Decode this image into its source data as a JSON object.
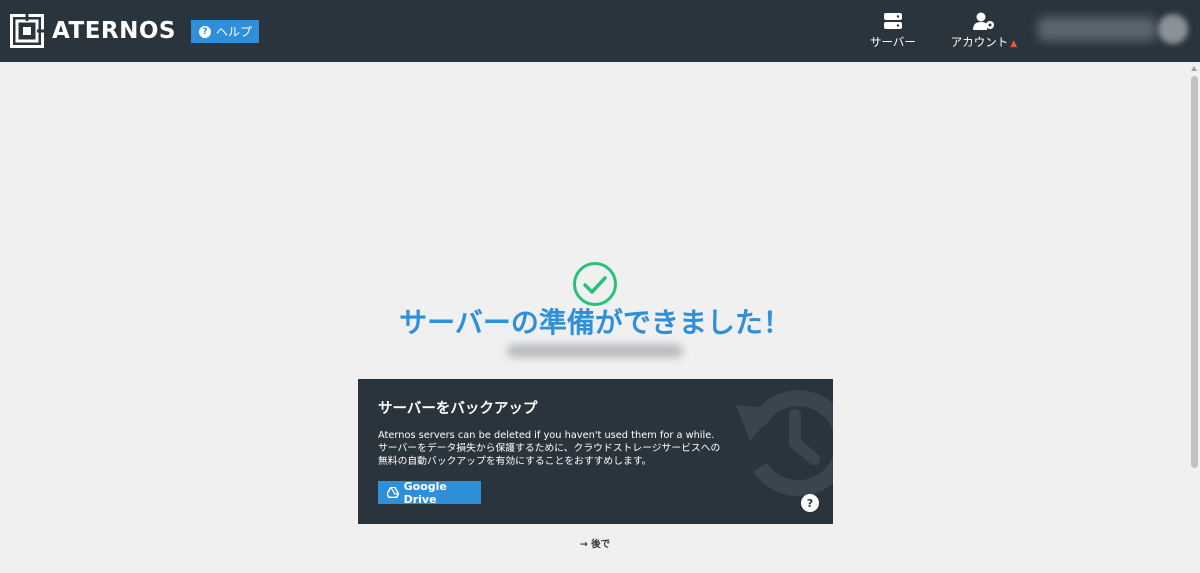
{
  "header": {
    "brand": "ATERNOS",
    "help_label": "ヘルプ",
    "nav": {
      "server_label": "サーバー",
      "account_label": "アカウント",
      "account_warning": "▲"
    }
  },
  "main": {
    "title": "サーバーの準備ができました！",
    "backup": {
      "title": "サーバーをバックアップ",
      "line1": "Aternos servers can be deleted if you haven't used them for a while.",
      "line2": "サーバーをデータ損失から保護するために、クラウドストレージサービスへの",
      "line3": "無料の自動バックアップを有効にすることをおすすめします。",
      "button_label": "Google Drive",
      "help_glyph": "?"
    },
    "later_label": "→ 後で"
  },
  "colors": {
    "header_bg": "#2a343d",
    "accent": "#2f8fd8",
    "success": "#27c17b",
    "warning": "#e8563d",
    "page_bg": "#f0f0f0"
  }
}
